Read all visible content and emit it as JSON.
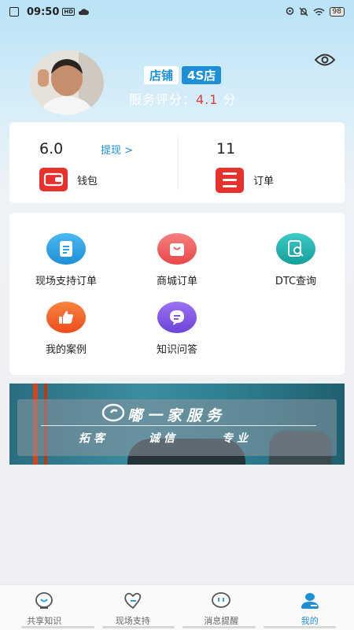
{
  "status": {
    "time": "09:50",
    "hd": "HD",
    "battery": "98"
  },
  "profile": {
    "tag_store": "店铺",
    "tag_type": "4S店",
    "score_label": "服务评分：",
    "score_value": "4.1",
    "score_unit": " 分"
  },
  "stats": {
    "wallet_value": "6.0",
    "withdraw": "提现 >",
    "wallet_label": "钱包",
    "orders_value": "11",
    "orders_label": "订单"
  },
  "menu": [
    {
      "label": "现场支持订单",
      "icon": "document-icon",
      "color": "#2b9fe6"
    },
    {
      "label": "商城订单",
      "icon": "shopping-bag-icon",
      "color": "#ef5d5d"
    },
    {
      "label": "DTC查询",
      "icon": "search-doc-icon",
      "color": "#21b5b0"
    },
    {
      "label": "我的案例",
      "icon": "thumbs-up-icon",
      "color": "#f2652a"
    },
    {
      "label": "知识问答",
      "icon": "chat-bubble-icon",
      "color": "#7f56e4"
    }
  ],
  "banner": {
    "title": "嘟一家服务",
    "slogan_1": "拓客",
    "slogan_2": "诚信",
    "slogan_3": "专业"
  },
  "nav": [
    {
      "label": "共享知识",
      "icon": "lightbulb-icon"
    },
    {
      "label": "现场支持",
      "icon": "heart-icon"
    },
    {
      "label": "消息提醒",
      "icon": "message-icon"
    },
    {
      "label": "我的",
      "icon": "person-icon",
      "active": true
    }
  ],
  "colors": {
    "accent": "#1e8fd6",
    "score_red": "#e53935",
    "icon_red": "#e8302c"
  }
}
